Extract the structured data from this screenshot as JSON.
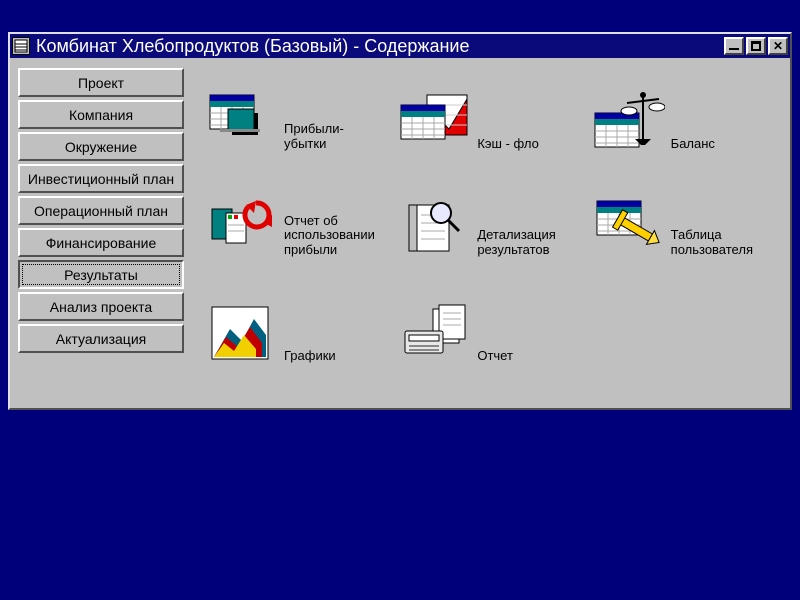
{
  "window": {
    "title": "Комбинат Хлебопродуктов (Базовый) - Содержание"
  },
  "sidebar": {
    "items": [
      {
        "label": "Проект"
      },
      {
        "label": "Компания"
      },
      {
        "label": "Окружение"
      },
      {
        "label": "Инвестиционный план"
      },
      {
        "label": "Операционный план"
      },
      {
        "label": "Финансирование"
      },
      {
        "label": "Результаты"
      },
      {
        "label": "Анализ проекта"
      },
      {
        "label": "Актуализация"
      }
    ],
    "active_index": 6
  },
  "content": {
    "items": [
      {
        "key": "profit-loss",
        "label": "Прибыли-\nубытки"
      },
      {
        "key": "cash-flow",
        "label": "Кэш - фло"
      },
      {
        "key": "balance",
        "label": "Баланс"
      },
      {
        "key": "profit-usage",
        "label": "Отчет об\nиспользовании\nприбыли"
      },
      {
        "key": "detail-results",
        "label": "Детализация\nрезультатов"
      },
      {
        "key": "user-table",
        "label": "Таблица\nпользователя"
      },
      {
        "key": "charts",
        "label": "Графики"
      },
      {
        "key": "report",
        "label": "Отчет"
      }
    ]
  }
}
